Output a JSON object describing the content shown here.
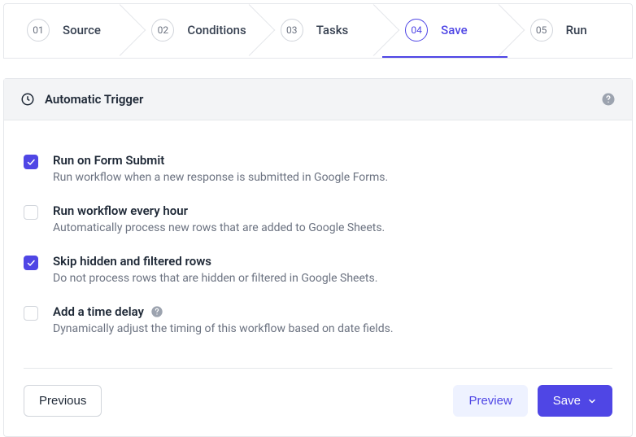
{
  "stepper": {
    "steps": [
      {
        "num": "01",
        "label": "Source"
      },
      {
        "num": "02",
        "label": "Conditions"
      },
      {
        "num": "03",
        "label": "Tasks"
      },
      {
        "num": "04",
        "label": "Save"
      },
      {
        "num": "05",
        "label": "Run"
      }
    ],
    "active_index": 3
  },
  "panel": {
    "title": "Automatic Trigger"
  },
  "options": [
    {
      "checked": true,
      "title": "Run on Form Submit",
      "desc": "Run workflow when a new response is submitted in Google Forms.",
      "help": false
    },
    {
      "checked": false,
      "title": "Run workflow every hour",
      "desc": "Automatically process new rows that are added to Google Sheets.",
      "help": false
    },
    {
      "checked": true,
      "title": "Skip hidden and filtered rows",
      "desc": "Do not process rows that are hidden or filtered in Google Sheets.",
      "help": false
    },
    {
      "checked": false,
      "title": "Add a time delay",
      "desc": "Dynamically adjust the timing of this workflow based on date fields.",
      "help": true
    }
  ],
  "footer": {
    "previous": "Previous",
    "preview": "Preview",
    "save": "Save"
  },
  "colors": {
    "accent": "#4f46e5"
  }
}
